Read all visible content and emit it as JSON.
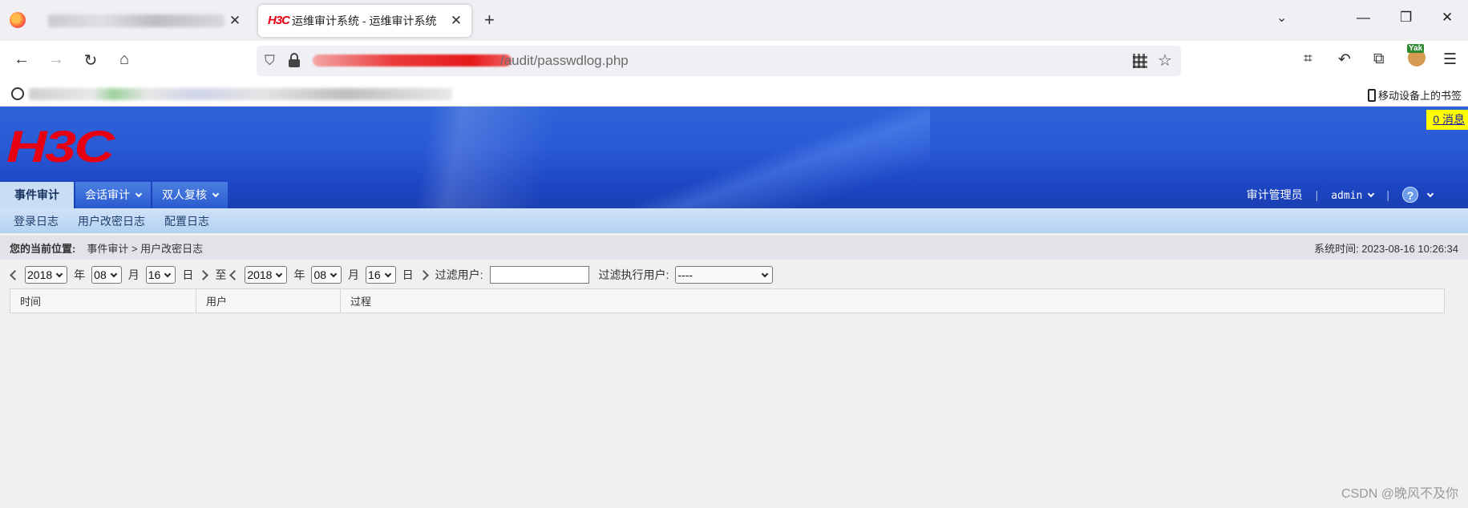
{
  "browser": {
    "active_tab_title": "运维审计系统 - 运维审计系统",
    "active_tab_favicon": "H3C",
    "url_visible_fragment": "/audit/passwdlog.php",
    "mobile_bookmarks_label": "移动设备上的书签",
    "extension_badge": "Yak"
  },
  "app": {
    "brand": "H3C",
    "message_badge": "0 消息",
    "menu": [
      {
        "label": "事件审计",
        "active": true
      },
      {
        "label": "会话审计",
        "active": false
      },
      {
        "label": "双人复核",
        "active": false
      }
    ],
    "role": "审计管理员",
    "username": "admin",
    "help_glyph": "?",
    "submenu": [
      "登录日志",
      "用户改密日志",
      "配置日志"
    ],
    "breadcrumb": {
      "label": "您的当前位置:",
      "path": "事件审计 > 用户改密日志"
    },
    "system_time": "系统时间: 2023-08-16 10:26:34",
    "filter": {
      "from": {
        "year": "2018",
        "month": "08",
        "day": "16"
      },
      "to": {
        "year": "2018",
        "month": "08",
        "day": "16"
      },
      "year_unit": "年",
      "month_unit": "月",
      "day_unit": "日",
      "to_label": "至",
      "filter_user_label": "过滤用户:",
      "filter_user_value": "",
      "filter_exec_user_label": "过滤执行用户:",
      "filter_exec_user_value": "----"
    },
    "table": {
      "columns": [
        "时间",
        "用户",
        "过程"
      ],
      "rows": []
    }
  },
  "watermark": "CSDN @晚风不及你",
  "colors": {
    "brand_red": "#e60012",
    "banner_blue": "#2a5ad6",
    "message_yellow": "#ffff00"
  }
}
